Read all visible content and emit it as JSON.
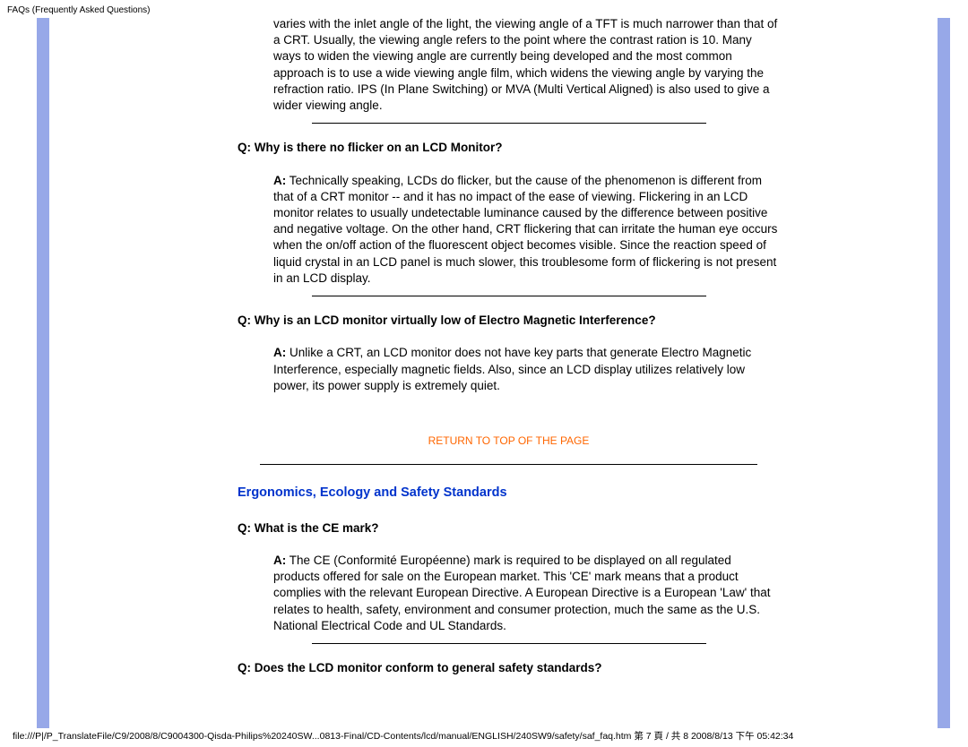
{
  "header_title": "FAQs (Frequently Asked Questions)",
  "intro_answer": "varies with the inlet angle of the light, the viewing angle of a TFT is much narrower than that of a CRT. Usually, the viewing angle refers to the point where the contrast ration is 10. Many ways to widen the viewing angle are currently being developed and the most common approach is to use a wide viewing angle film, which widens the viewing angle by varying the refraction ratio. IPS (In Plane Switching) or MVA (Multi Vertical Aligned) is also used to give a wider viewing angle.",
  "faqs": [
    {
      "q": "Q: Why is there no flicker on an LCD Monitor?",
      "a_label": "A:",
      "a_text": " Technically speaking, LCDs do flicker, but the cause of the phenomenon is different from that of a CRT monitor -- and it has no impact of the ease of viewing. Flickering in an LCD monitor relates to usually undetectable luminance caused by the difference between positive and negative voltage. On the other hand, CRT flickering that can irritate the human eye occurs when the on/off action of the fluorescent object becomes visible. Since the reaction speed of liquid crystal in an LCD panel is much slower, this troublesome form of flickering is not present in an LCD display."
    },
    {
      "q": "Q: Why is an LCD monitor virtually low of Electro Magnetic Interference?",
      "a_label": "A:",
      "a_text": " Unlike a CRT, an LCD monitor does not have key parts that generate Electro Magnetic Interference, especially magnetic fields. Also, since an LCD display utilizes relatively low power, its power supply is extremely quiet."
    }
  ],
  "return_link": "RETURN TO TOP OF THE PAGE",
  "section_heading": "Ergonomics, Ecology and Safety Standards",
  "faqs2": [
    {
      "q": "Q: What is the CE mark?",
      "a_label": "A:",
      "a_text": " The CE (Conformité Européenne) mark is required to be displayed on all regulated products offered for sale on the European market. This 'CE' mark means that a product complies with the relevant European Directive. A European Directive is a European 'Law' that relates to health, safety, environment and consumer protection, much the same as the U.S. National Electrical Code and UL Standards."
    },
    {
      "q": "Q: Does the LCD monitor conform to general safety standards?",
      "a_label": "",
      "a_text": ""
    }
  ],
  "footer_path": "file:///P|/P_TranslateFile/C9/2008/8/C9004300-Qisda-Philips%20240SW...0813-Final/CD-Contents/lcd/manual/ENGLISH/240SW9/safety/saf_faq.htm 第 7 頁 / 共 8 2008/8/13 下午 05:42:34"
}
